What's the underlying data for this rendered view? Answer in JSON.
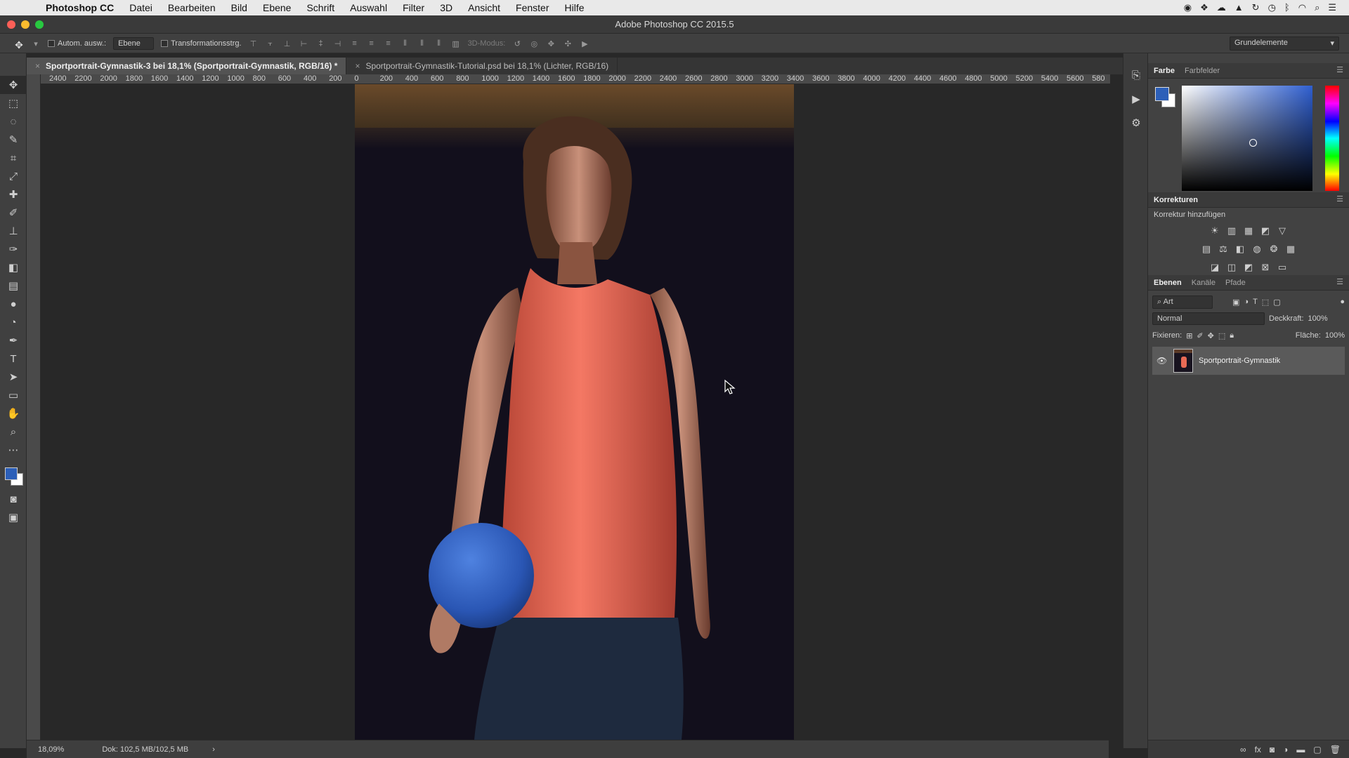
{
  "menubar": {
    "app_name": "Photoshop CC",
    "items": [
      "Datei",
      "Bearbeiten",
      "Bild",
      "Ebene",
      "Schrift",
      "Auswahl",
      "Filter",
      "3D",
      "Ansicht",
      "Fenster",
      "Hilfe"
    ]
  },
  "window": {
    "title": "Adobe Photoshop CC 2015.5"
  },
  "options": {
    "auto_select_label": "Autom. ausw.:",
    "auto_select_value": "Ebene",
    "transform_label": "Transformationsstrg.",
    "mode_3d_label": "3D-Modus:",
    "workspace": "Grundelemente"
  },
  "tabs": [
    {
      "label": "Sportportrait-Gymnastik-3 bei 18,1% (Sportportrait-Gymnastik, RGB/16) *",
      "active": true
    },
    {
      "label": "Sportportrait-Gymnastik-Tutorial.psd bei 18,1% (Lichter, RGB/16)",
      "active": false
    }
  ],
  "ruler": {
    "h_labels": [
      "2400",
      "2200",
      "2000",
      "1800",
      "1600",
      "1400",
      "1200",
      "1000",
      "800",
      "600",
      "400",
      "200",
      "0",
      "200",
      "400",
      "600",
      "800",
      "1000",
      "1200",
      "1400",
      "1600",
      "1800",
      "2000",
      "2200",
      "2400",
      "2600",
      "2800",
      "3000",
      "3200",
      "3400",
      "3600",
      "3800",
      "4000",
      "4200",
      "4400",
      "4600",
      "4800",
      "5000",
      "5200",
      "5400",
      "5600",
      "580"
    ]
  },
  "status": {
    "zoom": "18,09%",
    "doc": "Dok: 102,5 MB/102,5 MB"
  },
  "color_panel": {
    "tabs": [
      "Farbe",
      "Farbfelder"
    ],
    "foreground": "#2c5fb8",
    "background": "#ffffff"
  },
  "adjustments": {
    "title": "Korrekturen",
    "subtitle": "Korrektur hinzufügen"
  },
  "layers_panel": {
    "tabs": [
      "Ebenen",
      "Kanäle",
      "Pfade"
    ],
    "filter_kind": "Art",
    "blend_mode": "Normal",
    "opacity_label": "Deckkraft:",
    "opacity_value": "100%",
    "lock_label": "Fixieren:",
    "fill_label": "Fläche:",
    "fill_value": "100%",
    "layers": [
      {
        "name": "Sportportrait-Gymnastik",
        "visible": true
      }
    ]
  },
  "colors": {
    "accent": "#2c5fb8",
    "shirt": "#e86a55",
    "ball": "#2f5fc0"
  }
}
